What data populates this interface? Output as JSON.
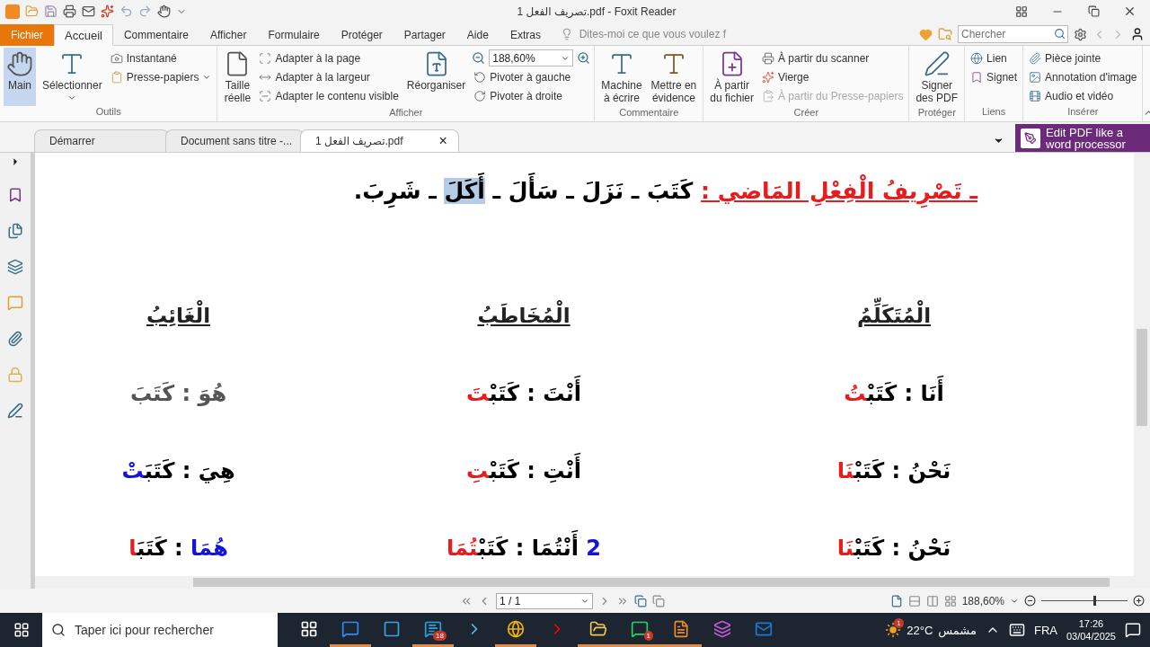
{
  "title_bar": {
    "title": "تصريف الفعل 1.pdf - Foxit Reader"
  },
  "menu_tabs": [
    {
      "label": "Fichier",
      "kind": "file",
      "selected": false
    },
    {
      "label": "Accueil",
      "kind": "tab",
      "selected": true
    },
    {
      "label": "Commentaire",
      "kind": "tab",
      "selected": false
    },
    {
      "label": "Afficher",
      "kind": "tab",
      "selected": false
    },
    {
      "label": "Formulaire",
      "kind": "tab",
      "selected": false
    },
    {
      "label": "Protéger",
      "kind": "tab",
      "selected": false
    },
    {
      "label": "Partager",
      "kind": "tab",
      "selected": false
    },
    {
      "label": "Aide",
      "kind": "tab",
      "selected": false
    },
    {
      "label": "Extras",
      "kind": "tab",
      "selected": false
    }
  ],
  "tell_me": {
    "placeholder": "Dites-moi ce que vous voulez f"
  },
  "search": {
    "placeholder": "Chercher"
  },
  "ribbon": {
    "groups": [
      {
        "title": "Outils",
        "columns": [
          {
            "kind": "large",
            "label": "Main",
            "selected": true,
            "dropdown": false
          },
          {
            "kind": "large",
            "label": "Sélectionner",
            "selected": false,
            "dropdown": true
          },
          {
            "kind": "stack",
            "items": [
              {
                "kind": "small",
                "label": "Instantané",
                "disabled": false,
                "dropdown": false
              },
              {
                "kind": "small",
                "label": "Presse-papiers",
                "disabled": false,
                "dropdown": true
              }
            ]
          }
        ]
      },
      {
        "title": "Afficher",
        "columns": [
          {
            "kind": "large",
            "label": "Taille\nréelle",
            "selected": false,
            "dropdown": false
          },
          {
            "kind": "stack",
            "items": [
              {
                "kind": "small",
                "label": "Adapter à la page",
                "disabled": false,
                "dropdown": false
              },
              {
                "kind": "small",
                "label": "Adapter à la largeur",
                "disabled": false,
                "dropdown": false
              },
              {
                "kind": "small",
                "label": "Adapter le contenu visible",
                "disabled": false,
                "dropdown": false
              }
            ]
          },
          {
            "kind": "large",
            "label": "Réorganiser",
            "selected": false,
            "dropdown": false
          },
          {
            "kind": "stack",
            "items": [
              {
                "kind": "zoom",
                "value": "188,60%"
              },
              {
                "kind": "small",
                "label": "Pivoter à gauche",
                "disabled": false,
                "dropdown": false
              },
              {
                "kind": "small",
                "label": "Pivoter à droite",
                "disabled": false,
                "dropdown": false
              }
            ]
          }
        ]
      },
      {
        "title": "Commentaire",
        "columns": [
          {
            "kind": "large",
            "label": "Machine\nà écrire",
            "selected": false,
            "dropdown": false
          },
          {
            "kind": "large",
            "label": "Mettre en\névidence",
            "selected": false,
            "dropdown": false
          }
        ]
      },
      {
        "title": "Créer",
        "columns": [
          {
            "kind": "large",
            "label": "À partir\ndu fichier",
            "selected": false,
            "dropdown": false
          },
          {
            "kind": "stack",
            "items": [
              {
                "kind": "small",
                "label": "À partir du scanner",
                "disabled": false,
                "dropdown": false
              },
              {
                "kind": "small",
                "label": "Vierge",
                "disabled": false,
                "dropdown": false
              },
              {
                "kind": "small",
                "label": "À partir du Presse-papiers",
                "disabled": true,
                "dropdown": false
              }
            ]
          }
        ]
      },
      {
        "title": "Protéger",
        "columns": [
          {
            "kind": "large",
            "label": "Signer\ndes PDF",
            "selected": false,
            "dropdown": false
          }
        ]
      },
      {
        "title": "Liens",
        "columns": [
          {
            "kind": "stack",
            "items": [
              {
                "kind": "small",
                "label": "Lien",
                "disabled": false,
                "dropdown": false
              },
              {
                "kind": "small",
                "label": "Signet",
                "disabled": false,
                "dropdown": false
              }
            ]
          }
        ]
      },
      {
        "title": "Insérer",
        "columns": [
          {
            "kind": "stack",
            "items": [
              {
                "kind": "small",
                "label": "Pièce jointe",
                "disabled": false,
                "dropdown": false
              },
              {
                "kind": "small",
                "label": "Annotation d'image",
                "disabled": false,
                "dropdown": false
              },
              {
                "kind": "small",
                "label": "Audio et vidéo",
                "disabled": false,
                "dropdown": false
              }
            ]
          }
        ]
      }
    ]
  },
  "doc_tabs": [
    {
      "label": "Démarrer",
      "selected": false,
      "closable": false
    },
    {
      "label": "Document sans titre -...",
      "selected": false,
      "closable": false
    },
    {
      "label": "تصريف الفعل 1.pdf",
      "selected": true,
      "closable": true
    }
  ],
  "close_symbol": "×",
  "promo": {
    "label": "Edit PDF like a word processor"
  },
  "document": {
    "heading": [
      {
        "text": "ـ تَصْرِيفُ الْفِعْلِ المَاضي :",
        "color": "#e81c1c",
        "underline": true,
        "highlighted": false
      },
      {
        "text": " كَتَبَ ـ نَزَلَ ـ سَأَلَ ـ ",
        "color": "#000000",
        "underline": false,
        "highlighted": false
      },
      {
        "text": "أَكَلَ",
        "color": "#000000",
        "underline": false,
        "highlighted": true
      },
      {
        "text": " ـ شَرِبَ.",
        "color": "#000000",
        "underline": false,
        "highlighted": false
      }
    ],
    "columns": [
      {
        "title": "الْمُتَكَلِّمُ",
        "rows": [
          {
            "parts": [
              {
                "text": "أَنَا  :  كَتَبْ",
                "color": "#000000"
              },
              {
                "text": "تُ",
                "color": "#e81c1c"
              }
            ]
          },
          {
            "parts": [
              {
                "text": "نَحْنُ : كَتَبْ",
                "color": "#000000"
              },
              {
                "text": "نَا",
                "color": "#e81c1c"
              }
            ]
          },
          {
            "parts": [
              {
                "text": "نَحْنُ : كَتَبْ",
                "color": "#000000"
              },
              {
                "text": "نَا",
                "color": "#e81c1c"
              }
            ]
          }
        ]
      },
      {
        "title": "الْمُخَاطَبُ",
        "rows": [
          {
            "parts": [
              {
                "text": "أَنْتَ : كَتَبْ",
                "color": "#000000"
              },
              {
                "text": "تَ",
                "color": "#e81c1c"
              }
            ]
          },
          {
            "parts": [
              {
                "text": "أَنْتِ : كَتَبْ",
                "color": "#000000"
              },
              {
                "text": "تِ",
                "color": "#e81c1c"
              }
            ]
          },
          {
            "parts": [
              {
                "text": "2",
                "color": "#1414d8"
              },
              {
                "text": "  أَنْتُمَا : كَتَبْ",
                "color": "#000000"
              },
              {
                "text": "تُمَا",
                "color": "#e81c1c"
              }
            ]
          }
        ]
      },
      {
        "title": "الْغَائِبُ",
        "rows": [
          {
            "parts": [
              {
                "text": "هُوَ : كَتَبَ",
                "color": "#555555"
              }
            ]
          },
          {
            "parts": [
              {
                "text": "هِيَ : كَتَبَ",
                "color": "#000000"
              },
              {
                "text": "تْ",
                "color": "#1414d8"
              }
            ]
          },
          {
            "parts": [
              {
                "text": "هُمَا",
                "color": "#1414d8"
              },
              {
                "text": " : كَتَبَ",
                "color": "#000000"
              },
              {
                "text": "ا",
                "color": "#e81c1c"
              }
            ]
          }
        ]
      }
    ]
  },
  "status_bar": {
    "page": "1 / 1",
    "zoom": "188,60%",
    "zoom_slider": {
      "level": 0.61
    }
  },
  "taskbar": {
    "search_placeholder": "Taper ici pour rechercher",
    "apps": [
      {
        "running": false
      },
      {
        "running": true
      },
      {
        "running": false
      },
      {
        "running": true,
        "badge": "18"
      },
      {
        "running": false
      },
      {
        "running": true
      },
      {
        "running": false
      },
      {
        "running": true
      },
      {
        "running": true,
        "badge": "1"
      },
      {
        "running": true
      },
      {
        "running": false
      },
      {
        "running": false
      }
    ],
    "weather": {
      "temperature": "22°C",
      "condition": "مشمس",
      "badge": "1"
    },
    "language": "FRA",
    "time": "17:26",
    "date": "03/04/2025"
  }
}
